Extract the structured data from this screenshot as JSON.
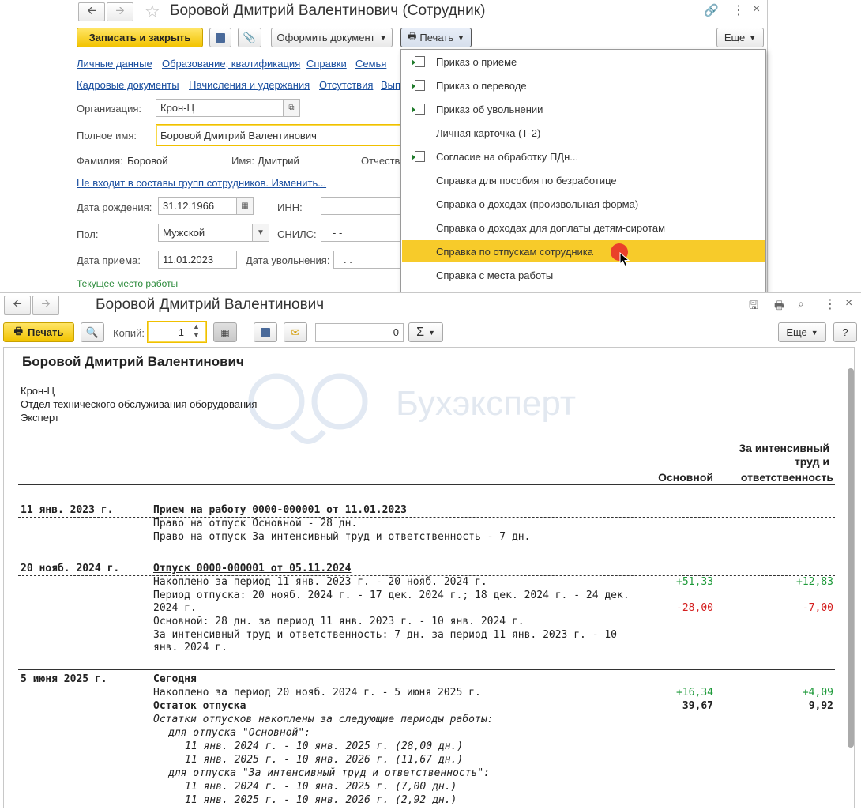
{
  "employee_window": {
    "title": "Боровой Дмитрий Валентинович (Сотрудник)",
    "toolbar": {
      "save_close": "Записать и закрыть",
      "create_doc": "Оформить документ",
      "print": "Печать",
      "more": "Еще"
    },
    "links_row1": [
      "Личные данные",
      "Образование, квалификация",
      "Справки",
      "Семья"
    ],
    "links_row2": [
      "Кадровые документы",
      "Начисления и удержания",
      "Отсутствия",
      "Вып"
    ],
    "org_label": "Организация:",
    "org_value": "Крон-Ц",
    "fullname_label": "Полное имя:",
    "fullname_value": "Боровой Дмитрий Валентинович",
    "surname_label": "Фамилия:",
    "surname_value": "Боровой",
    "name_label": "Имя:",
    "name_value": "Дмитрий",
    "patronymic_label": "Отчество",
    "groups_link": "Не входит в составы групп сотрудников. Изменить...",
    "birth_label": "Дата рождения:",
    "birth_value": "31.12.1966",
    "inn_label": "ИНН:",
    "gender_label": "Пол:",
    "gender_value": "Мужской",
    "snils_label": "СНИЛС:",
    "snils_value": "-   -",
    "hire_label": "Дата приема:",
    "hire_value": "11.01.2023",
    "dismiss_label": "Дата увольнения:",
    "dismiss_value": ".   .",
    "current_work": "Текущее место работы"
  },
  "print_menu": {
    "items": [
      {
        "label": "Приказ о приеме",
        "icon": "doc-arrow-icon"
      },
      {
        "label": "Приказ о переводе",
        "icon": "doc-arrow-icon"
      },
      {
        "label": "Приказ об увольнении",
        "icon": "doc-arrow-icon"
      },
      {
        "label": "Личная карточка (Т-2)",
        "icon": ""
      },
      {
        "label": "Согласие на обработку ПДн...",
        "icon": "doc-arrow-icon"
      },
      {
        "label": "Справка для пособия по безработице",
        "icon": ""
      },
      {
        "label": "Справка о доходах (произвольная форма)",
        "icon": ""
      },
      {
        "label": "Справка о доходах для доплаты детям-сиротам",
        "icon": ""
      },
      {
        "label": "Справка по отпускам сотрудника",
        "icon": "",
        "highlighted": true
      },
      {
        "label": "Справка с места работы",
        "icon": ""
      }
    ]
  },
  "report_window": {
    "title": "Боровой Дмитрий Валентинович",
    "toolbar": {
      "print": "Печать",
      "copies_label": "Копий:",
      "copies_value": "1",
      "sum_value": "0",
      "sigma": "Σ",
      "more": "Еще",
      "help": "?"
    },
    "watermark": "Бухэксперт"
  },
  "report": {
    "title": "Боровой Дмитрий Валентинович",
    "org": "Крон-Ц",
    "department": "Отдел технического обслуживания оборудования",
    "position": "Эксперт",
    "col_main": "Основной",
    "col_intensive_1": "За интенсивный",
    "col_intensive_2": "труд и",
    "col_intensive_3": "ответственность",
    "s1": {
      "date": "11 янв. 2023 г.",
      "header": "Прием на работу 0000-000001 от 11.01.2023",
      "line1": "Право на отпуск Основной - 28 дн.",
      "line2": "Право на отпуск За интенсивный труд и ответственность - 7 дн."
    },
    "s2": {
      "date": "20 нояб. 2024 г.",
      "header": "Отпуск 0000-000001 от 05.11.2024",
      "line1": "Накоплено за период 11 янв. 2023 г. - 20 нояб. 2024 г.",
      "line1_main": "+51,33",
      "line1_int": "+12,83",
      "line2a": "Период отпуска: 20 нояб. 2024 г. - 17 дек. 2024 г.; 18 дек. 2024 г. - 24 дек.",
      "line2b": "2024 г.",
      "line2_main": "-28,00",
      "line2_int": "-7,00",
      "line3": "Основной: 28 дн. за период 11 янв. 2023 г. - 10 янв. 2024 г.",
      "line4a": "За интенсивный труд и ответственность: 7 дн. за период 11 янв. 2023 г. - 10",
      "line4b": "янв. 2024 г."
    },
    "s3": {
      "date": "5 июня 2025 г.",
      "header": "Сегодня",
      "line1": "Накоплено за период 20 нояб. 2024 г. - 5 июня 2025 г.",
      "line1_main": "+16,34",
      "line1_int": "+4,09",
      "balance": "Остаток отпуска",
      "balance_main": "39,67",
      "balance_int": "9,92",
      "note": "Остатки отпусков накоплены за следующие периоды работы:",
      "v1": "для отпуска \"Основной\":",
      "v1p1": "11 янв. 2024 г. - 10 янв. 2025 г. (28,00 дн.)",
      "v1p2": "11 янв. 2025 г. - 10 янв. 2026 г. (11,67 дн.)",
      "v2": "для отпуска \"За интенсивный труд и ответственность\":",
      "v2p1": "11 янв. 2024 г. - 10 янв. 2025 г. (7,00 дн.)",
      "v2p2": "11 янв. 2025 г. - 10 янв. 2026 г. (2,92 дн.)"
    }
  }
}
